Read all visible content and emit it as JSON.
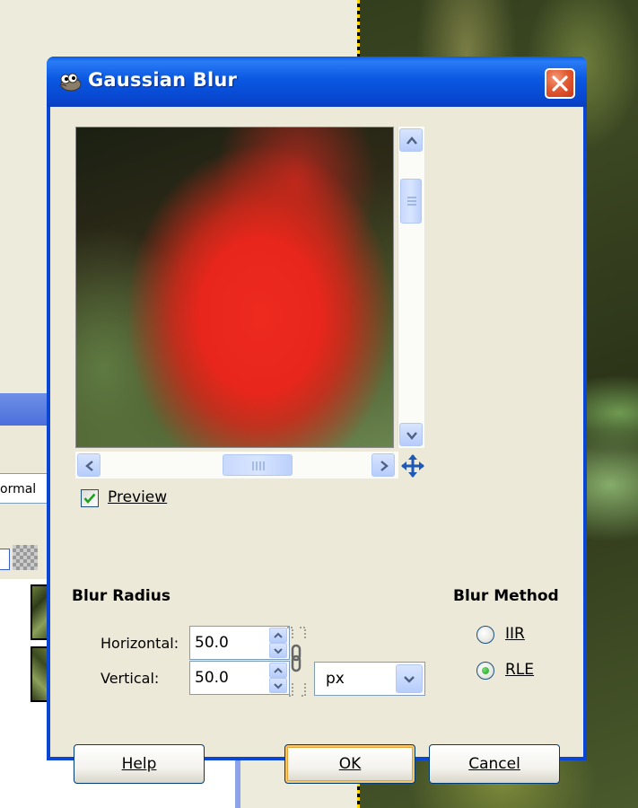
{
  "background": {
    "mode_text": "ormal"
  },
  "dialog": {
    "title": "Gaussian Blur",
    "preview": {
      "checkbox_label": "Preview",
      "checked": true
    },
    "blur_radius": {
      "section_title": "Blur Radius",
      "horizontal_label": "Horizontal:",
      "horizontal_value": "50.0",
      "vertical_label": "Vertical:",
      "vertical_value": "50.0",
      "unit": "px"
    },
    "blur_method": {
      "section_title": "Blur Method",
      "options": [
        "IIR",
        "RLE"
      ],
      "selected": "RLE"
    },
    "buttons": {
      "help": "Help",
      "ok": "OK",
      "cancel": "Cancel"
    }
  },
  "colors": {
    "titlebar": "#0a58e2",
    "dialog_face": "#ece9d8",
    "close_button": "#e35b33",
    "checkmark": "#21a121"
  },
  "icons": [
    "gimp-wilber-icon",
    "close-icon",
    "scroll-up-icon",
    "scroll-down-icon",
    "scroll-left-icon",
    "scroll-right-icon",
    "navigate-move-icon",
    "chain-link-icon",
    "dropdown-arrow-icon"
  ]
}
